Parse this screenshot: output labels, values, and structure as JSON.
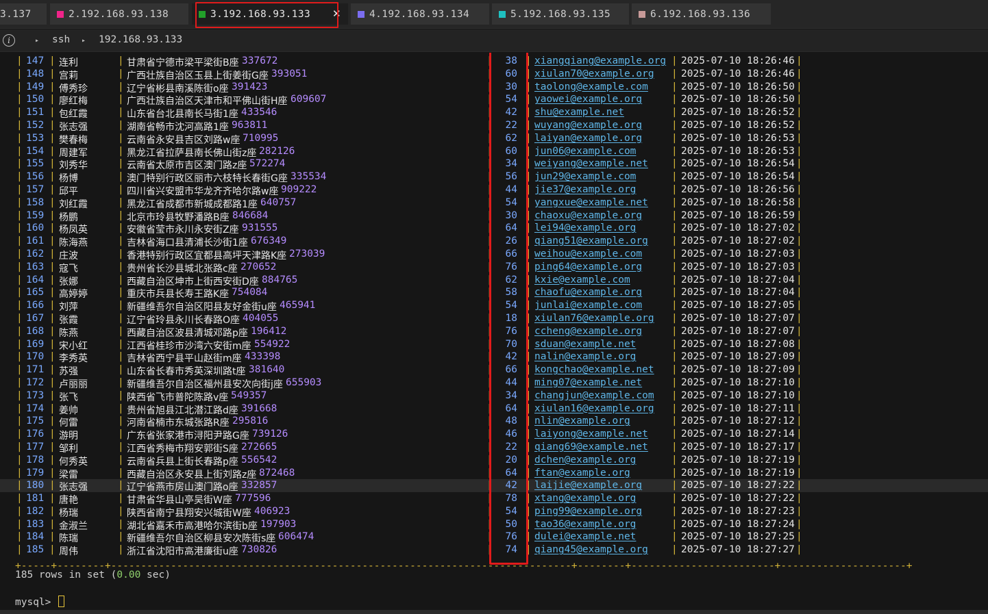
{
  "tabs": [
    {
      "label": "3.137",
      "color": "#9a9a9a",
      "active": false
    },
    {
      "label": "2.192.168.93.138",
      "color": "#f0248a",
      "active": false
    },
    {
      "label": "3.192.168.93.133",
      "color": "#22a02a",
      "active": true
    },
    {
      "label": "4.192.168.93.134",
      "color": "#7b6df0",
      "active": false
    },
    {
      "label": "5.192.168.93.135",
      "color": "#1fc0c0",
      "active": false
    },
    {
      "label": "6.192.168.93.136",
      "color": "#c79a98",
      "active": false
    }
  ],
  "pathbar": {
    "seg1": "ssh",
    "seg2": "192.168.93.133"
  },
  "table": {
    "highlighted_row_id": "180",
    "rows": [
      [
        "147",
        "连利",
        "甘肃省宁德市梁平梁街B座",
        "337672",
        "38",
        "xiangqiang@example.org",
        "2025-07-10 18:26:46"
      ],
      [
        "148",
        "宫莉",
        "广西壮族自治区玉县上街姜街G座",
        "393051",
        "60",
        "xiulan70@example.org",
        "2025-07-10 18:26:46"
      ],
      [
        "149",
        "傅秀珍",
        "辽宁省彬县南溪陈街o座",
        "391423",
        "30",
        "taolong@example.com",
        "2025-07-10 18:26:50"
      ],
      [
        "150",
        "廖红梅",
        "广西壮族自治区天津市和平佛山街H座",
        "609607",
        "54",
        "yaowei@example.org",
        "2025-07-10 18:26:50"
      ],
      [
        "151",
        "包红霞",
        "山东省台北县南长马街1座",
        "433546",
        "42",
        "shu@example.net",
        "2025-07-10 18:26:52"
      ],
      [
        "152",
        "张志强",
        "湖南省畅市沈河高路1座",
        "963811",
        "22",
        "wuyang@example.org",
        "2025-07-10 18:26:52"
      ],
      [
        "153",
        "樊春梅",
        "云南省永安县吉区刘路w座",
        "710995",
        "62",
        "laiyan@example.org",
        "2025-07-10 18:26:53"
      ],
      [
        "154",
        "周建军",
        "黑龙江省拉萨县南长佛山街z座",
        "282126",
        "60",
        "jun06@example.com",
        "2025-07-10 18:26:53"
      ],
      [
        "155",
        "刘秀华",
        "云南省太原市吉区澳门路z座",
        "572274",
        "34",
        "weiyang@example.net",
        "2025-07-10 18:26:54"
      ],
      [
        "156",
        "杨博",
        "澳门特别行政区丽市六枝特长春街G座",
        "335534",
        "56",
        "jun29@example.com",
        "2025-07-10 18:26:54"
      ],
      [
        "157",
        "邱平",
        "四川省兴安盟市华龙齐齐哈尔路w座",
        "909222",
        "44",
        "jie37@example.org",
        "2025-07-10 18:26:56"
      ],
      [
        "158",
        "刘红霞",
        "黑龙江省成都市新城成都路1座",
        "640757",
        "54",
        "yangxue@example.net",
        "2025-07-10 18:26:58"
      ],
      [
        "159",
        "杨鹏",
        "北京市玲县牧野潘路B座",
        "846684",
        "30",
        "chaoxu@example.org",
        "2025-07-10 18:26:59"
      ],
      [
        "160",
        "杨凤英",
        "安徽省莹市永川永安街Z座",
        "931555",
        "64",
        "lei94@example.org",
        "2025-07-10 18:27:02"
      ],
      [
        "161",
        "陈海燕",
        "吉林省海口县清浦长沙街1座",
        "676349",
        "26",
        "qiang51@example.org",
        "2025-07-10 18:27:02"
      ],
      [
        "162",
        "庄波",
        "香港特别行政区宜都县高坪天津路K座",
        "273039",
        "66",
        "weihou@example.com",
        "2025-07-10 18:27:03"
      ],
      [
        "163",
        "寇飞",
        "贵州省长沙县城北张路c座",
        "270652",
        "76",
        "ping64@example.org",
        "2025-07-10 18:27:03"
      ],
      [
        "164",
        "张娜",
        "西藏自治区坤市上街西安街D座",
        "884765",
        "62",
        "kxie@example.com",
        "2025-07-10 18:27:04"
      ],
      [
        "165",
        "高婷婷",
        "重庆市兵县长寿王路K座",
        "754084",
        "58",
        "chaofu@example.org",
        "2025-07-10 18:27:04"
      ],
      [
        "166",
        "刘萍",
        "新疆维吾尔自治区阳县友好金街u座",
        "465941",
        "54",
        "junlai@example.com",
        "2025-07-10 18:27:05"
      ],
      [
        "167",
        "张霞",
        "辽宁省玲县永川长春路O座",
        "404055",
        "18",
        "xiulan76@example.org",
        "2025-07-10 18:27:07"
      ],
      [
        "168",
        "陈燕",
        "西藏自治区波县清城邓路p座",
        "196412",
        "76",
        "ccheng@example.org",
        "2025-07-10 18:27:07"
      ],
      [
        "169",
        "宋小红",
        "江西省桂珍市沙湾六安街m座",
        "554922",
        "70",
        "sduan@example.net",
        "2025-07-10 18:27:08"
      ],
      [
        "170",
        "李秀英",
        "吉林省西宁县平山赵街m座",
        "433398",
        "42",
        "nalin@example.org",
        "2025-07-10 18:27:09"
      ],
      [
        "171",
        "苏强",
        "山东省长春市秀英深圳路t座",
        "381640",
        "66",
        "kongchao@example.net",
        "2025-07-10 18:27:09"
      ],
      [
        "172",
        "卢丽丽",
        "新疆维吾尔自治区福州县安次向街j座",
        "655903",
        "44",
        "ming07@example.net",
        "2025-07-10 18:27:10"
      ],
      [
        "173",
        "张飞",
        "陕西省飞市普陀陈路v座",
        "549357",
        "34",
        "changjun@example.com",
        "2025-07-10 18:27:10"
      ],
      [
        "174",
        "姜帅",
        "贵州省旭县江北潜江路d座",
        "391668",
        "64",
        "xiulan16@example.org",
        "2025-07-10 18:27:11"
      ],
      [
        "175",
        "何雷",
        "河南省楠市东城张路R座",
        "295816",
        "48",
        "nlin@example.org",
        "2025-07-10 18:27:12"
      ],
      [
        "176",
        "游明",
        "广东省张家港市浔阳尹路G座",
        "739126",
        "46",
        "laiyong@example.net",
        "2025-07-10 18:27:14"
      ],
      [
        "177",
        "邹利",
        "江西省秀梅市翔安郭街S座",
        "272665",
        "22",
        "qiang69@example.net",
        "2025-07-10 18:27:17"
      ],
      [
        "178",
        "何秀英",
        "云南省兵县上街长春路p座",
        "556542",
        "20",
        "dchen@example.org",
        "2025-07-10 18:27:19"
      ],
      [
        "179",
        "梁雷",
        "西藏自治区永安县上街刘路z座",
        "872468",
        "64",
        "ftan@example.org",
        "2025-07-10 18:27:19"
      ],
      [
        "180",
        "张志强",
        "辽宁省燕市房山澳门路o座",
        "332857",
        "42",
        "laijie@example.org",
        "2025-07-10 18:27:22"
      ],
      [
        "181",
        "唐艳",
        "甘肃省华县山亭吴街W座",
        "777596",
        "78",
        "xtang@example.org",
        "2025-07-10 18:27:22"
      ],
      [
        "182",
        "杨瑞",
        "陕西省南宁县翔安兴城街W座",
        "406923",
        "54",
        "ping99@example.org",
        "2025-07-10 18:27:23"
      ],
      [
        "183",
        "金淑兰",
        "湖北省嘉禾市高港哈尔滨街b座",
        "197903",
        "50",
        "tao36@example.org",
        "2025-07-10 18:27:24"
      ],
      [
        "184",
        "陈瑞",
        "新疆维吾尔自治区柳县安次陈街s座",
        "606474",
        "76",
        "dulei@example.net",
        "2025-07-10 18:27:25"
      ],
      [
        "185",
        "周伟",
        "浙江省沈阳市高港廉街u座",
        "730826",
        "74",
        "qiang45@example.org",
        "2025-07-10 18:27:27"
      ]
    ]
  },
  "result": {
    "prefix": "185 rows in set (",
    "time": "0.00",
    "suffix": " sec)"
  },
  "prompt": "mysql> "
}
